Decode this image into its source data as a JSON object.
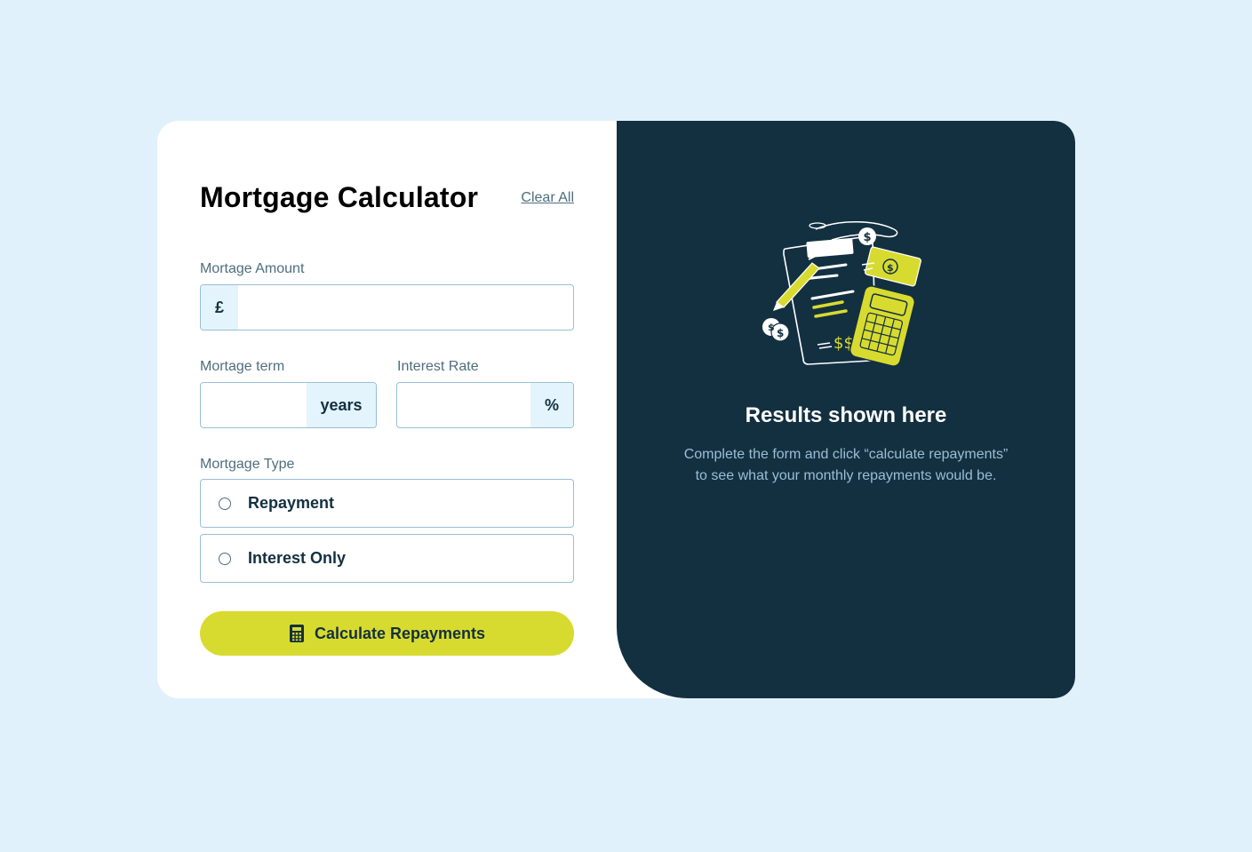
{
  "form": {
    "title": "Mortgage Calculator",
    "clear_all": "Clear All",
    "amount": {
      "label": "Mortage Amount",
      "prefix": "£",
      "value": ""
    },
    "term": {
      "label": "Mortage term",
      "suffix": "years",
      "value": ""
    },
    "rate": {
      "label": "Interest Rate",
      "suffix": "%",
      "value": ""
    },
    "type": {
      "label": "Mortgage Type",
      "options": [
        {
          "label": "Repayment",
          "selected": false
        },
        {
          "label": "Interest Only",
          "selected": false
        }
      ]
    },
    "submit": {
      "label": "Calculate Repayments",
      "icon": "calculator-icon"
    }
  },
  "results": {
    "illustration": "empty-results-illustration",
    "title": "Results shown here",
    "description": "Complete the form and click “calculate repayments” to see what your monthly repayments would be."
  },
  "colors": {
    "background": "#e1f1fc",
    "card": "#ffffff",
    "results_panel": "#133041",
    "accent_lime": "#d8db2f",
    "label_slate": "#4e6e7e",
    "border": "#9abed5",
    "affix_bg": "#e3f4fc"
  }
}
